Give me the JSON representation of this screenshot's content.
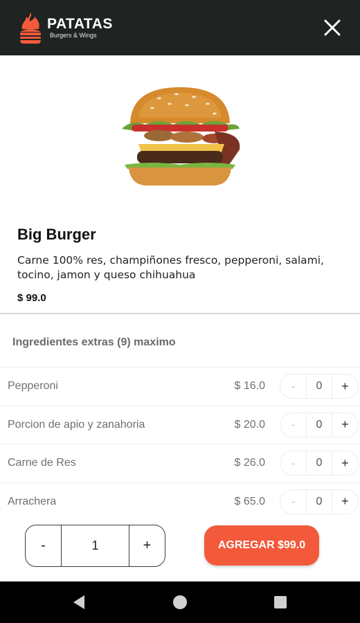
{
  "header": {
    "brand_title": "PATATAS",
    "brand_subtitle": "Burgers & Wings",
    "close_icon": "close-icon",
    "background": "#1f2321"
  },
  "product": {
    "name": "Big Burger",
    "description": "Carne 100% res, champiñones fresco, pepperoni, salami, tocino, jamon y queso chihuahua",
    "price": "$ 99.0",
    "image_icon": "burger-image"
  },
  "extras": {
    "title": "Ingredientes extras (9) maximo",
    "items": [
      {
        "name": "Pepperoni",
        "price": "$ 16.0",
        "minus": "-",
        "qty": "0",
        "plus": "+"
      },
      {
        "name": "Porcion de apio y zanahoria",
        "price": "$ 20.0",
        "minus": "-",
        "qty": "0",
        "plus": "+"
      },
      {
        "name": "Carne de Res",
        "price": "$ 26.0",
        "minus": "-",
        "qty": "0",
        "plus": "+"
      },
      {
        "name": "Arrachera",
        "price": "$ 65.0",
        "minus": "-",
        "qty": "0",
        "plus": "+"
      }
    ]
  },
  "order": {
    "minus": "-",
    "quantity": "1",
    "plus": "+",
    "add_label": "AGREGAR $99.0",
    "accent": "#f25a3b"
  },
  "system_nav": {
    "back_icon": "back-triangle-icon",
    "home_icon": "home-circle-icon",
    "recents_icon": "recents-square-icon"
  }
}
